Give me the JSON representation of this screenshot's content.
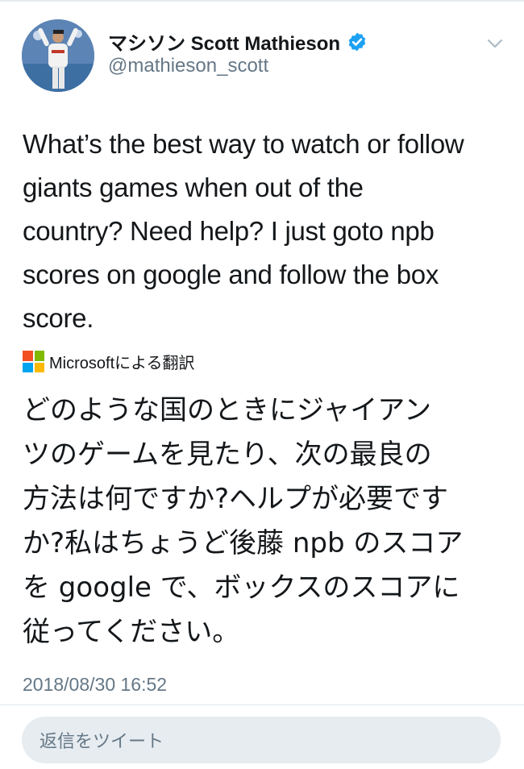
{
  "tweet": {
    "author": {
      "display_name": "マシソン Scott Mathieson",
      "handle": "@mathieson_scott",
      "verified": true
    },
    "text_lines": [
      "What’s the best way to watch or follow",
      "giants games when out of the",
      "country? Need help? I just goto npb",
      "scores on google and follow the box",
      "score."
    ],
    "translation": {
      "provider_label": "Microsoftによる翻訳",
      "lines": [
        "どのような国のときにジャイアン",
        "ツのゲームを見たり、次の最良の",
        "方法は何ですか?ヘルプが必要です",
        "か?私はちょうど後藤 npb のスコア",
        "を google で、ボックスのスコアに",
        "従ってください。"
      ]
    },
    "timestamp": "2018/08/30 16:52"
  },
  "reply": {
    "placeholder": "返信をツイート"
  },
  "icons": {
    "verified": "verified-badge-icon",
    "menu": "chevron-down-icon",
    "translator": "microsoft-logo-icon"
  },
  "colors": {
    "verified_blue": "#1da1f2",
    "secondary_text": "#657786",
    "reply_bg": "#e6ecf0"
  }
}
